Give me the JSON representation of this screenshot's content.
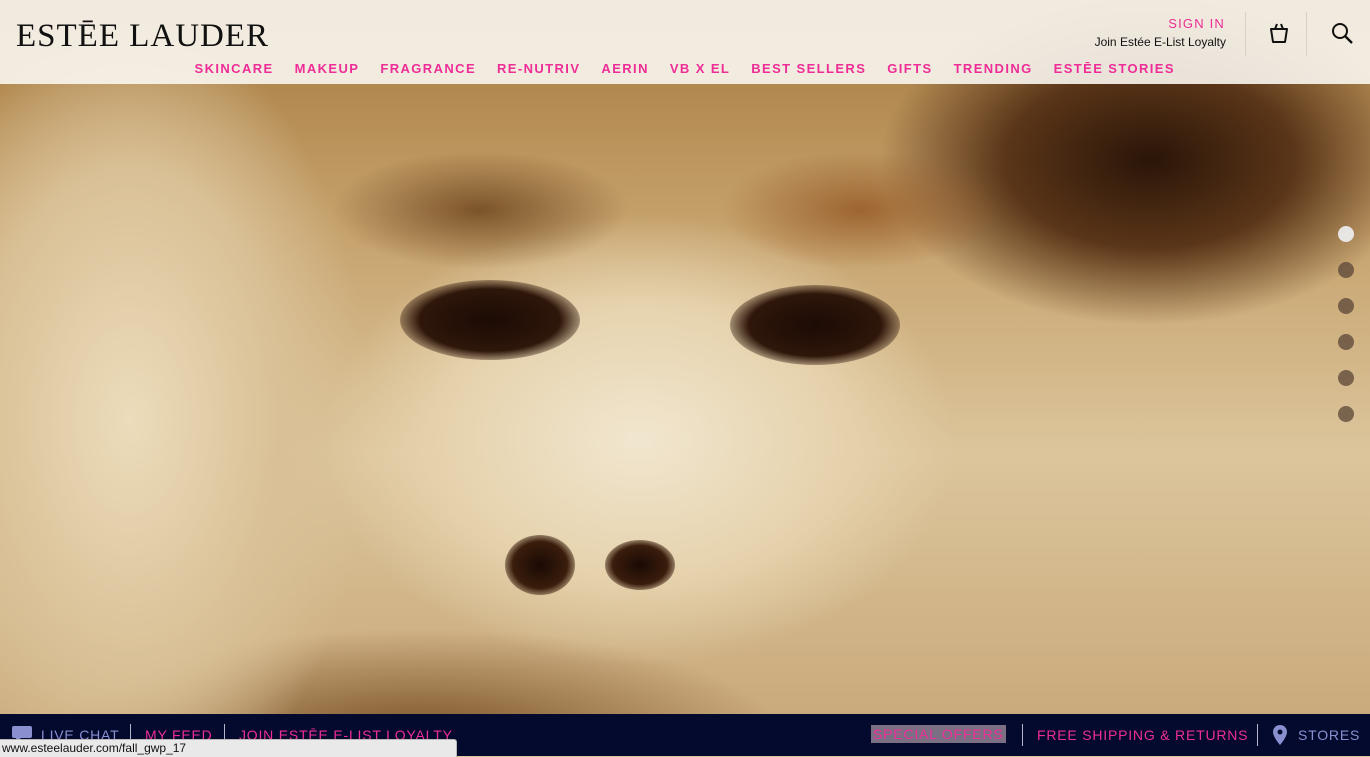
{
  "brand": {
    "logo": "ESTĒE LAUDER"
  },
  "header": {
    "sign_in": "SIGN IN",
    "loyalty": "Join Estée E-List Loyalty",
    "icons": {
      "bag": "shopping-bag-icon",
      "search": "search-icon"
    }
  },
  "nav": {
    "items": [
      {
        "label": "SKINCARE"
      },
      {
        "label": "MAKEUP"
      },
      {
        "label": "FRAGRANCE"
      },
      {
        "label": "RE-NUTRIV"
      },
      {
        "label": "AERIN"
      },
      {
        "label": "VB X EL"
      },
      {
        "label": "BEST SELLERS"
      },
      {
        "label": "GIFTS"
      },
      {
        "label": "TRENDING"
      },
      {
        "label": "ESTĒE STORIES"
      }
    ]
  },
  "carousel": {
    "slide_count": 6,
    "active_index": 0
  },
  "footer": {
    "live_chat": "LIVE CHAT",
    "my_feed": "MY FEED",
    "join_loyalty": "JOIN ESTĒE E-LIST LOYALTY",
    "special_offers": "SPECIAL OFFERS",
    "free_shipping": "FREE SHIPPING & RETURNS",
    "stores": "STORES",
    "icons": {
      "chat": "chat-bubble-icon",
      "stores": "location-pin-icon"
    }
  },
  "status_bar": {
    "url": "www.esteelauder.com/fall_gwp_17"
  },
  "colors": {
    "accent_pink": "#ee2d97",
    "footer_navy": "#040a2e"
  }
}
